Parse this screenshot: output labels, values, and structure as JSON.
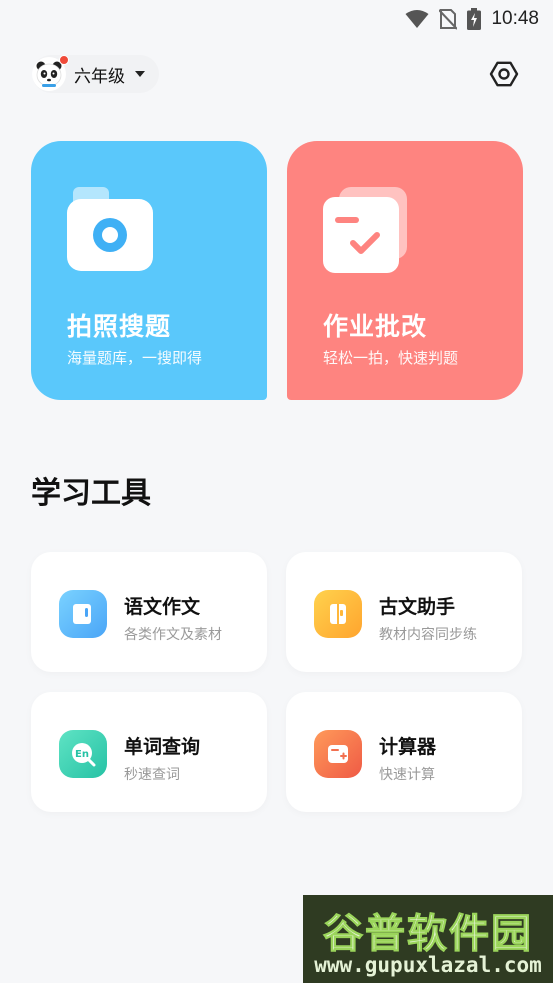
{
  "status_bar": {
    "time": "10:48"
  },
  "header": {
    "grade": "六年级"
  },
  "cards": [
    {
      "title": "拍照搜题",
      "subtitle": "海量题库，一搜即得",
      "color": "#5ac8fb"
    },
    {
      "title": "作业批改",
      "subtitle": "轻松一拍，快速判题",
      "color": "#fe8480"
    }
  ],
  "tools_section": {
    "title": "学习工具"
  },
  "tools": [
    {
      "title": "语文作文",
      "subtitle": "各类作文及素材",
      "icon": "book-icon"
    },
    {
      "title": "古文助手",
      "subtitle": "教材内容同步练",
      "icon": "scroll-icon"
    },
    {
      "title": "单词查询",
      "subtitle": "秒速查词",
      "icon": "english-search-icon"
    },
    {
      "title": "计算器",
      "subtitle": "快速计算",
      "icon": "calculator-icon"
    }
  ],
  "watermark": {
    "title": "谷普软件园",
    "url": "www.gupuxlazal.com"
  }
}
